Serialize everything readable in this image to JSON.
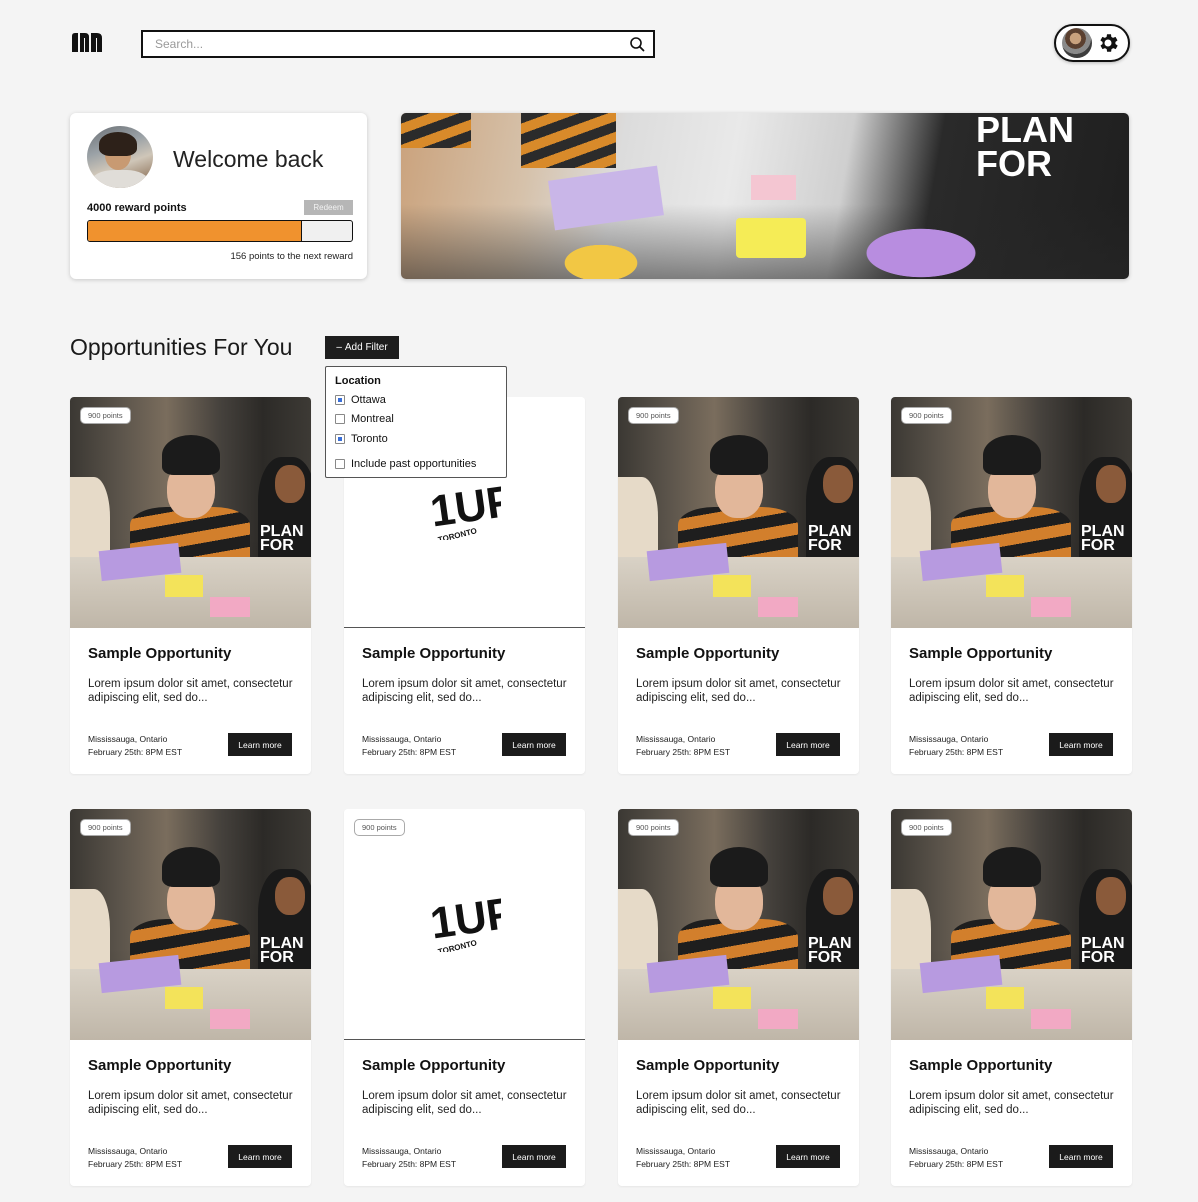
{
  "header": {
    "search_placeholder": "Search..."
  },
  "welcome": {
    "title": "Welcome back",
    "points_label": "4000 reward points",
    "redeem_label": "Redeem",
    "progress_fraction": 0.81,
    "next_reward_text": "156 points to the next reward"
  },
  "section": {
    "title": "Opportunities For You",
    "add_filter_label": "Add Filter"
  },
  "filter": {
    "heading": "Location",
    "options": [
      {
        "label": "Ottawa",
        "checked": true
      },
      {
        "label": "Montreal",
        "checked": false
      },
      {
        "label": "Toronto",
        "checked": true
      }
    ],
    "past_label": "Include past opportunities"
  },
  "cards": [
    {
      "badge": "900 points",
      "title": "Sample Opportunity",
      "desc": "Lorem ipsum dolor sit amet, consectetur adipiscing elit, sed do...",
      "location": "Mississauga, Ontario",
      "date": "February 25th: 8PM EST",
      "button": "Learn more"
    },
    {
      "badge": "",
      "title": "Sample Opportunity",
      "desc": "Lorem ipsum dolor sit amet, consectetur adipiscing elit, sed do...",
      "location": "Mississauga, Ontario",
      "date": "February 25th: 8PM EST",
      "button": "Learn more"
    },
    {
      "badge": "900 points",
      "title": "Sample Opportunity",
      "desc": "Lorem ipsum dolor sit amet, consectetur adipiscing elit, sed do...",
      "location": "Mississauga, Ontario",
      "date": "February 25th: 8PM EST",
      "button": "Learn more"
    },
    {
      "badge": "900 points",
      "title": "Sample Opportunity",
      "desc": "Lorem ipsum dolor sit amet, consectetur adipiscing elit, sed do...",
      "location": "Mississauga, Ontario",
      "date": "February 25th: 8PM EST",
      "button": "Learn more"
    },
    {
      "badge": "900 points",
      "title": "Sample Opportunity",
      "desc": "Lorem ipsum dolor sit amet, consectetur adipiscing elit, sed do...",
      "location": "Mississauga, Ontario",
      "date": "February 25th: 8PM EST",
      "button": "Learn more"
    },
    {
      "badge": "900 points",
      "title": "Sample Opportunity",
      "desc": "Lorem ipsum dolor sit amet, consectetur adipiscing elit, sed do...",
      "location": "Mississauga, Ontario",
      "date": "February 25th: 8PM EST",
      "button": "Learn more"
    },
    {
      "badge": "900 points",
      "title": "Sample Opportunity",
      "desc": "Lorem ipsum dolor sit amet, consectetur adipiscing elit, sed do...",
      "location": "Mississauga, Ontario",
      "date": "February 25th: 8PM EST",
      "button": "Learn more"
    },
    {
      "badge": "900 points",
      "title": "Sample Opportunity",
      "desc": "Lorem ipsum dolor sit amet, consectetur adipiscing elit, sed do...",
      "location": "Mississauga, Ontario",
      "date": "February 25th: 8PM EST",
      "button": "Learn more"
    }
  ],
  "logo_text": {
    "brand": "1UP",
    "city": "TORONTO"
  },
  "banner_shirt_text": [
    "PLAN",
    "FOR"
  ],
  "card_shirt_text": [
    "PLAN",
    "FOR"
  ],
  "colors": {
    "accent": "#f0922e",
    "button_dark": "#1b1b1b",
    "checkbox_checked": "#3a6fd8"
  },
  "icons": {
    "search": "search-icon",
    "settings": "gear-icon",
    "logo": "app-logo-icon"
  }
}
